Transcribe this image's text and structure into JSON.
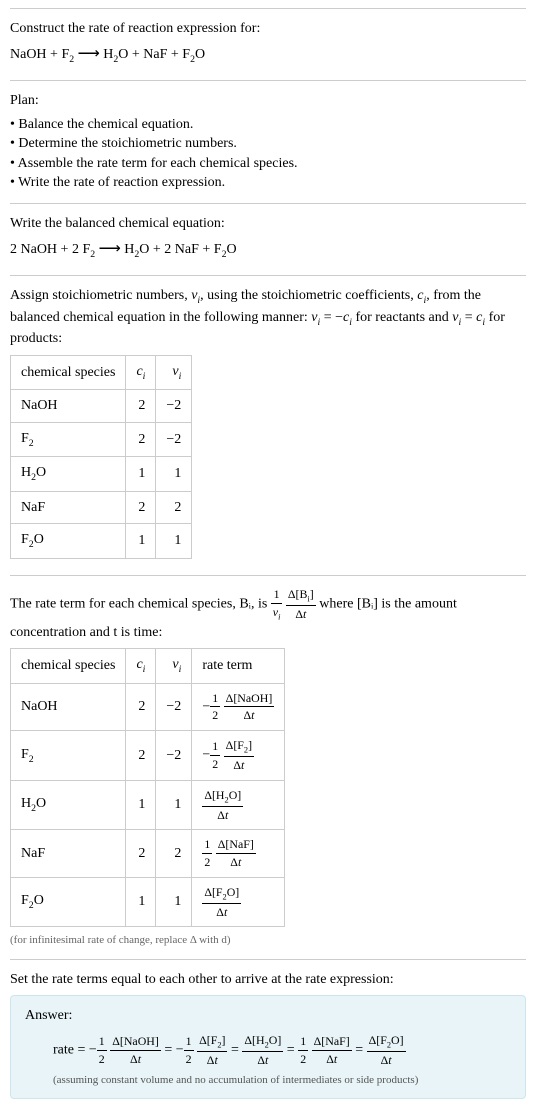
{
  "intro": {
    "prompt": "Construct the rate of reaction expression for:",
    "equation_unbalanced": "NaOH + F₂  ⟶  H₂O + NaF + F₂O"
  },
  "plan": {
    "heading": "Plan:",
    "items": [
      "Balance the chemical equation.",
      "Determine the stoichiometric numbers.",
      "Assemble the rate term for each chemical species.",
      "Write the rate of reaction expression."
    ]
  },
  "balanced": {
    "heading": "Write the balanced chemical equation:",
    "equation": "2 NaOH + 2 F₂  ⟶  H₂O + 2 NaF + F₂O"
  },
  "stoich": {
    "heading": "Assign stoichiometric numbers, νᵢ, using the stoichiometric coefficients, cᵢ, from the balanced chemical equation in the following manner: νᵢ = −cᵢ for reactants and νᵢ = cᵢ for products:",
    "cols": [
      "chemical species",
      "cᵢ",
      "νᵢ"
    ],
    "rows": [
      {
        "species": "NaOH",
        "c": "2",
        "v": "−2"
      },
      {
        "species": "F₂",
        "c": "2",
        "v": "−2"
      },
      {
        "species": "H₂O",
        "c": "1",
        "v": "1"
      },
      {
        "species": "NaF",
        "c": "2",
        "v": "2"
      },
      {
        "species": "F₂O",
        "c": "1",
        "v": "1"
      }
    ]
  },
  "rateterm": {
    "heading_pre": "The rate term for each chemical species, Bᵢ, is ",
    "heading_post": " where [Bᵢ] is the amount concentration and t is time:",
    "cols": [
      "chemical species",
      "cᵢ",
      "νᵢ",
      "rate term"
    ],
    "rows": [
      {
        "species": "NaOH",
        "c": "2",
        "v": "−2",
        "term_prefix": "−",
        "term_frac1_top": "1",
        "term_frac1_bot": "2",
        "term_frac2_top": "Δ[NaOH]",
        "term_frac2_bot": "Δt"
      },
      {
        "species": "F₂",
        "c": "2",
        "v": "−2",
        "term_prefix": "−",
        "term_frac1_top": "1",
        "term_frac1_bot": "2",
        "term_frac2_top": "Δ[F₂]",
        "term_frac2_bot": "Δt"
      },
      {
        "species": "H₂O",
        "c": "1",
        "v": "1",
        "term_prefix": "",
        "term_frac1_top": "",
        "term_frac1_bot": "",
        "term_frac2_top": "Δ[H₂O]",
        "term_frac2_bot": "Δt"
      },
      {
        "species": "NaF",
        "c": "2",
        "v": "2",
        "term_prefix": "",
        "term_frac1_top": "1",
        "term_frac1_bot": "2",
        "term_frac2_top": "Δ[NaF]",
        "term_frac2_bot": "Δt"
      },
      {
        "species": "F₂O",
        "c": "1",
        "v": "1",
        "term_prefix": "",
        "term_frac1_top": "",
        "term_frac1_bot": "",
        "term_frac2_top": "Δ[F₂O]",
        "term_frac2_bot": "Δt"
      }
    ],
    "note": "(for infinitesimal rate of change, replace Δ with d)"
  },
  "final": {
    "heading": "Set the rate terms equal to each other to arrive at the rate expression:",
    "answer_label": "Answer:",
    "rate_prefix": "rate = ",
    "assumption": "(assuming constant volume and no accumulation of intermediates or side products)"
  },
  "chart_data": {
    "type": "table",
    "title": "Stoichiometric numbers and rate terms",
    "tables": [
      {
        "columns": [
          "chemical species",
          "c_i",
          "ν_i"
        ],
        "rows": [
          [
            "NaOH",
            2,
            -2
          ],
          [
            "F2",
            2,
            -2
          ],
          [
            "H2O",
            1,
            1
          ],
          [
            "NaF",
            2,
            2
          ],
          [
            "F2O",
            1,
            1
          ]
        ]
      },
      {
        "columns": [
          "chemical species",
          "c_i",
          "ν_i",
          "rate term"
        ],
        "rows": [
          [
            "NaOH",
            2,
            -2,
            "-(1/2) Δ[NaOH]/Δt"
          ],
          [
            "F2",
            2,
            -2,
            "-(1/2) Δ[F2]/Δt"
          ],
          [
            "H2O",
            1,
            1,
            "Δ[H2O]/Δt"
          ],
          [
            "NaF",
            2,
            2,
            "(1/2) Δ[NaF]/Δt"
          ],
          [
            "F2O",
            1,
            1,
            "Δ[F2O]/Δt"
          ]
        ]
      }
    ],
    "rate_expression": "rate = -(1/2) Δ[NaOH]/Δt = -(1/2) Δ[F2]/Δt = Δ[H2O]/Δt = (1/2) Δ[NaF]/Δt = Δ[F2O]/Δt"
  }
}
